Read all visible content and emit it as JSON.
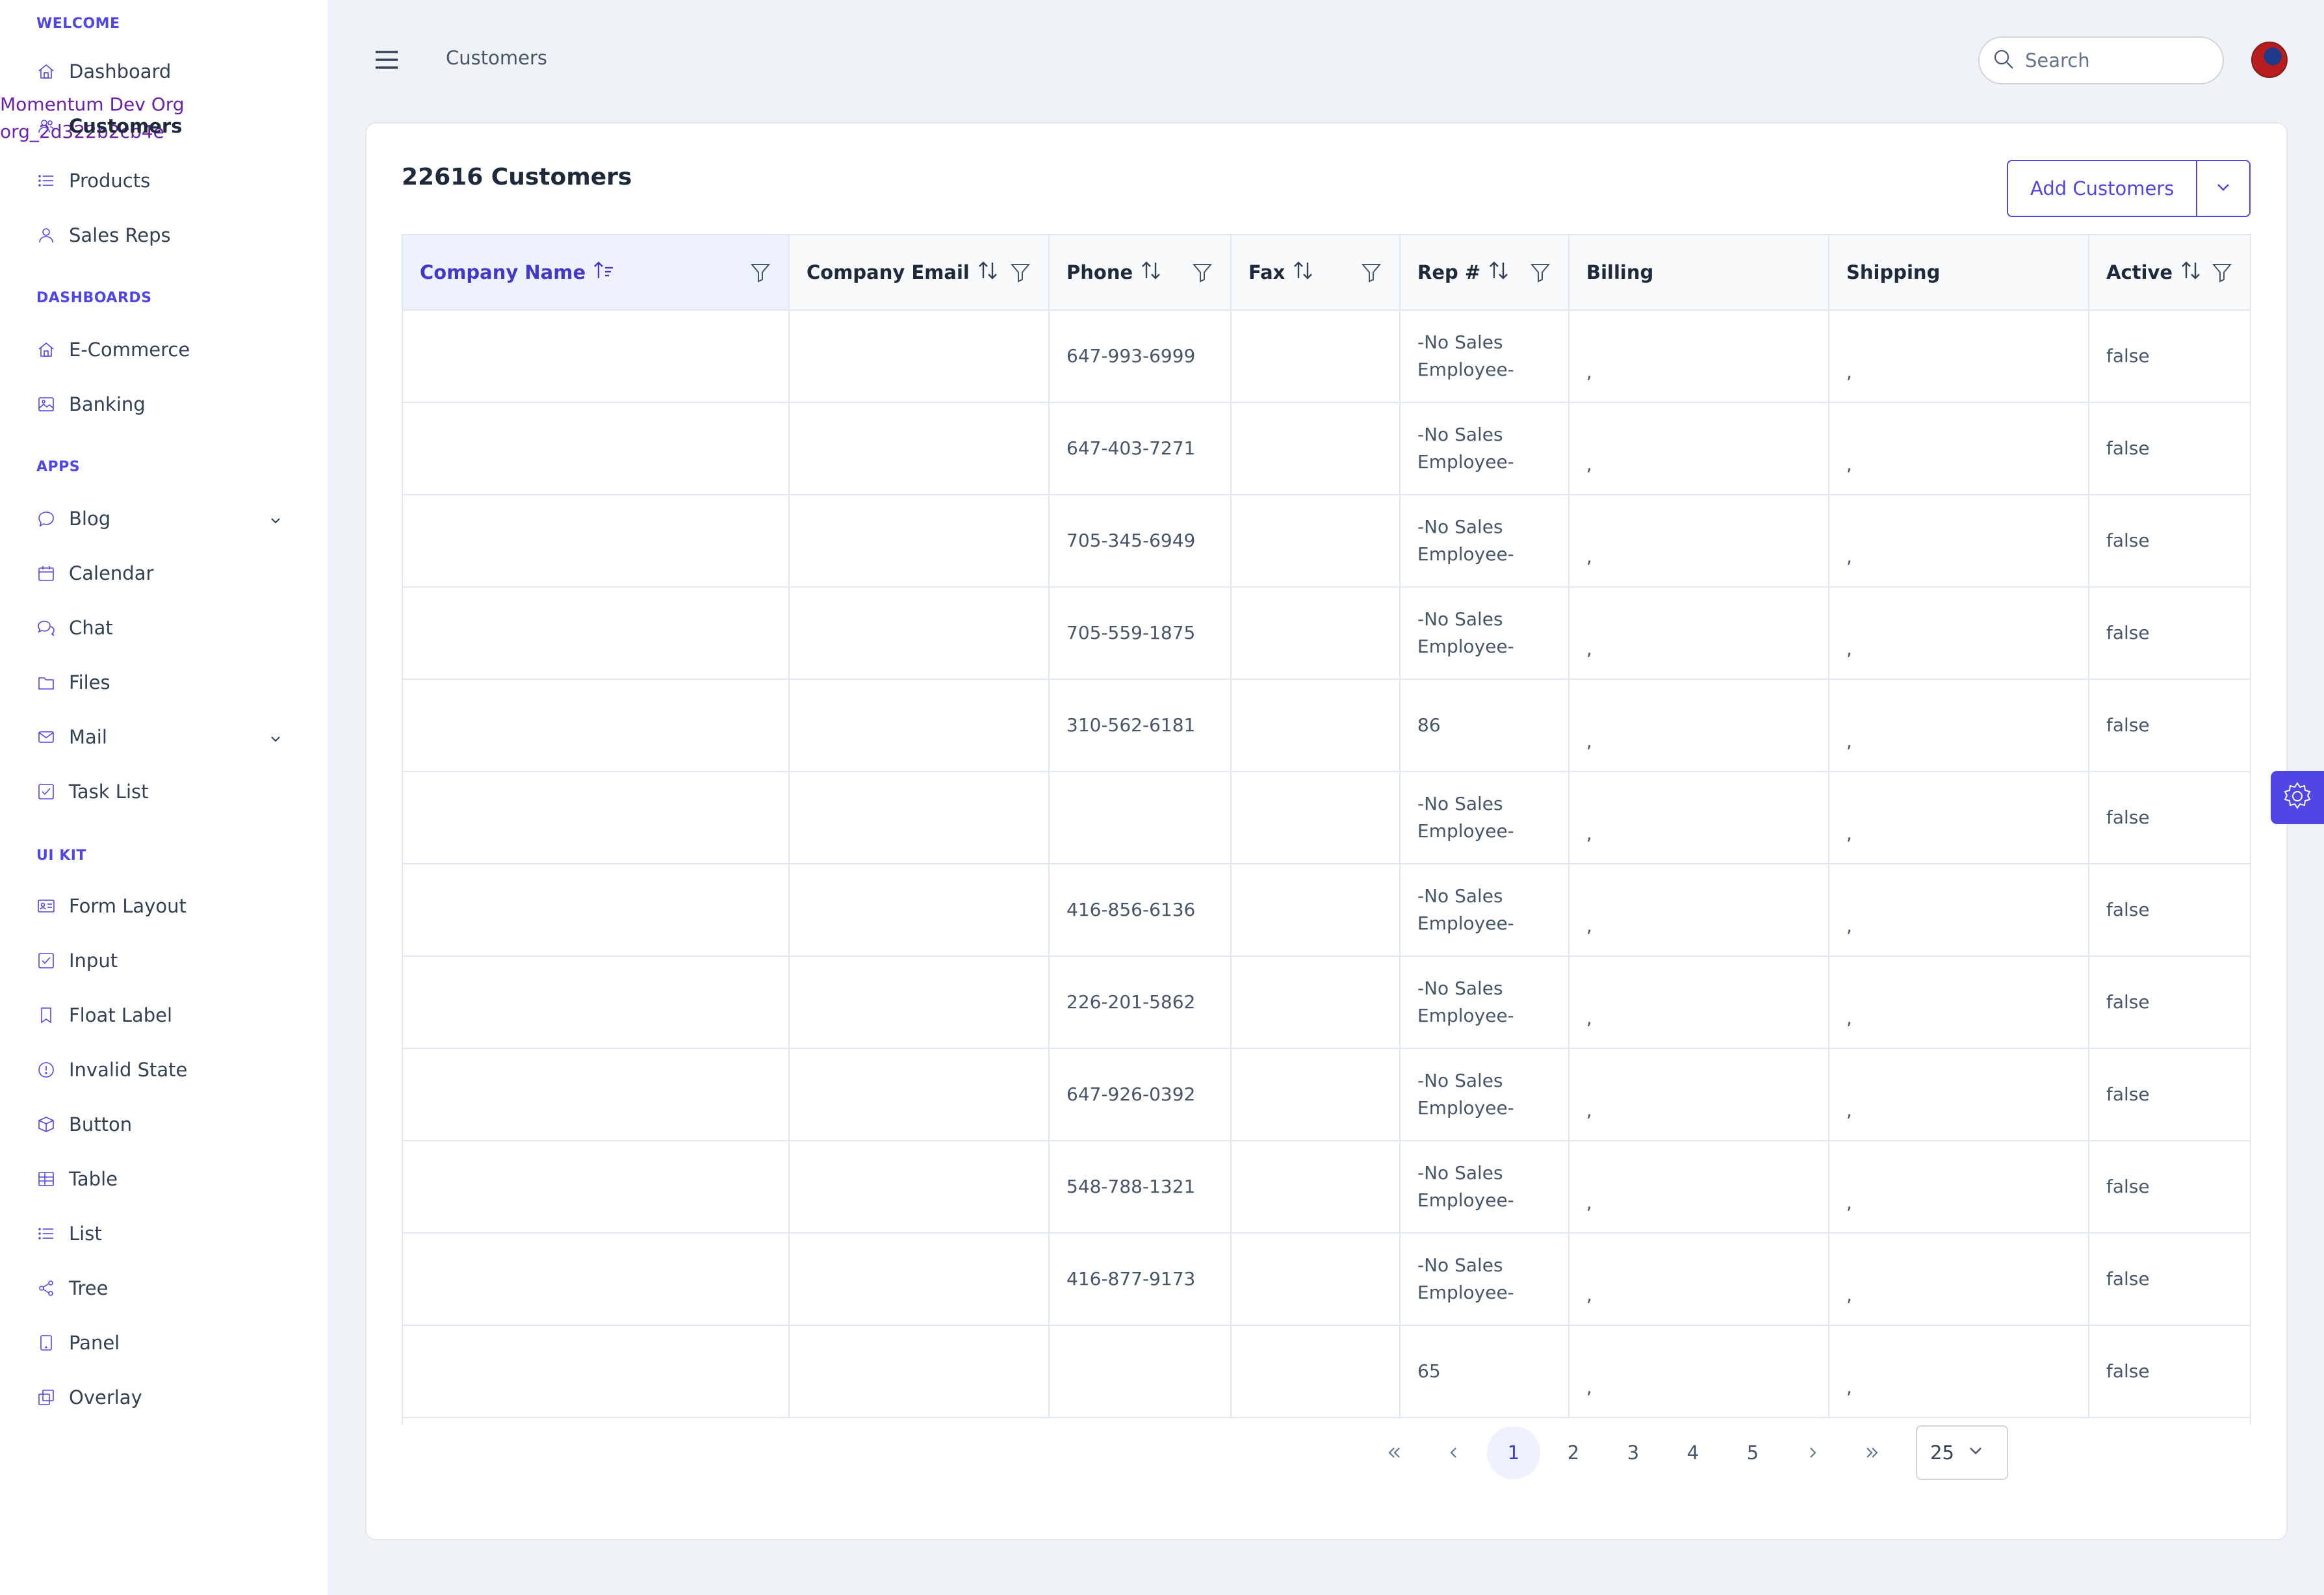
{
  "org": {
    "name": "Momentum Dev Org",
    "id": "org_2d322b2cb4e"
  },
  "sidebar": {
    "sections": [
      {
        "title": "WELCOME",
        "items": [
          {
            "label": "Dashboard",
            "icon": "home-icon"
          },
          {
            "label": "Customers",
            "icon": "users-icon",
            "active": true
          },
          {
            "label": "Products",
            "icon": "list-icon"
          },
          {
            "label": "Sales Reps",
            "icon": "user-icon"
          }
        ]
      },
      {
        "title": "DASHBOARDS",
        "items": [
          {
            "label": "E-Commerce",
            "icon": "home-icon"
          },
          {
            "label": "Banking",
            "icon": "image-icon"
          }
        ]
      },
      {
        "title": "APPS",
        "items": [
          {
            "label": "Blog",
            "icon": "comment-icon",
            "expandable": true
          },
          {
            "label": "Calendar",
            "icon": "calendar-icon"
          },
          {
            "label": "Chat",
            "icon": "comments-icon"
          },
          {
            "label": "Files",
            "icon": "folder-icon"
          },
          {
            "label": "Mail",
            "icon": "envelope-icon",
            "expandable": true
          },
          {
            "label": "Task List",
            "icon": "check-square-icon"
          }
        ]
      },
      {
        "title": "UI KIT",
        "items": [
          {
            "label": "Form Layout",
            "icon": "id-card-icon"
          },
          {
            "label": "Input",
            "icon": "check-square-icon"
          },
          {
            "label": "Float Label",
            "icon": "bookmark-icon"
          },
          {
            "label": "Invalid State",
            "icon": "exclamation-circle-icon"
          },
          {
            "label": "Button",
            "icon": "box-icon"
          },
          {
            "label": "Table",
            "icon": "table-icon"
          },
          {
            "label": "List",
            "icon": "list-icon"
          },
          {
            "label": "Tree",
            "icon": "share-alt-icon"
          },
          {
            "label": "Panel",
            "icon": "tablet-icon"
          },
          {
            "label": "Overlay",
            "icon": "clone-icon"
          }
        ]
      }
    ]
  },
  "topbar": {
    "breadcrumb": "Customers",
    "search_placeholder": "Search"
  },
  "card": {
    "title": "22616 Customers",
    "add_button": "Add Customers"
  },
  "table": {
    "columns": [
      {
        "label": "Company Name",
        "sortable": true,
        "filter": true,
        "sorted": "asc"
      },
      {
        "label": "Company Email",
        "sortable": true,
        "filter": true
      },
      {
        "label": "Phone",
        "sortable": true,
        "filter": true
      },
      {
        "label": "Fax",
        "sortable": true,
        "filter": true
      },
      {
        "label": "Rep #",
        "sortable": true,
        "filter": true
      },
      {
        "label": "Billing",
        "sortable": false,
        "filter": false
      },
      {
        "label": "Shipping",
        "sortable": false,
        "filter": false
      },
      {
        "label": "Active",
        "sortable": true,
        "filter": true
      }
    ],
    "rows": [
      {
        "company": "",
        "email": "",
        "phone": "647-993-6999",
        "fax": "",
        "rep": "-No Sales Employee-",
        "billing": ",",
        "shipping": ",",
        "active": "false"
      },
      {
        "company": "",
        "email": "",
        "phone": "647-403-7271",
        "fax": "",
        "rep": "-No Sales Employee-",
        "billing": ",",
        "shipping": ",",
        "active": "false"
      },
      {
        "company": "",
        "email": "",
        "phone": "705-345-6949",
        "fax": "",
        "rep": "-No Sales Employee-",
        "billing": ",",
        "shipping": ",",
        "active": "false"
      },
      {
        "company": "",
        "email": "",
        "phone": "705-559-1875",
        "fax": "",
        "rep": "-No Sales Employee-",
        "billing": ",",
        "shipping": ",",
        "active": "false"
      },
      {
        "company": "",
        "email": "",
        "phone": "310-562-6181",
        "fax": "",
        "rep": "86",
        "billing": ",",
        "shipping": ",",
        "active": "false"
      },
      {
        "company": "",
        "email": "",
        "phone": "",
        "fax": "",
        "rep": "-No Sales Employee-",
        "billing": ",",
        "shipping": ",",
        "active": "false"
      },
      {
        "company": "",
        "email": "",
        "phone": "416-856-6136",
        "fax": "",
        "rep": "-No Sales Employee-",
        "billing": ",",
        "shipping": ",",
        "active": "false"
      },
      {
        "company": "",
        "email": "",
        "phone": "226-201-5862",
        "fax": "",
        "rep": "-No Sales Employee-",
        "billing": ",",
        "shipping": ",",
        "active": "false"
      },
      {
        "company": "",
        "email": "",
        "phone": "647-926-0392",
        "fax": "",
        "rep": "-No Sales Employee-",
        "billing": ",",
        "shipping": ",",
        "active": "false"
      },
      {
        "company": "",
        "email": "",
        "phone": "548-788-1321",
        "fax": "",
        "rep": "-No Sales Employee-",
        "billing": ",",
        "shipping": ",",
        "active": "false"
      },
      {
        "company": "",
        "email": "",
        "phone": "416-877-9173",
        "fax": "",
        "rep": "-No Sales Employee-",
        "billing": ",",
        "shipping": ",",
        "active": "false"
      },
      {
        "company": "",
        "email": "",
        "phone": "",
        "fax": "",
        "rep": "65",
        "billing": ",",
        "shipping": ",",
        "active": "false"
      }
    ]
  },
  "paginator": {
    "pages": [
      "1",
      "2",
      "3",
      "4",
      "5"
    ],
    "current": "1",
    "rows_per_page": "25"
  },
  "colors": {
    "accent": "#4f46e5",
    "background": "#eff3f8",
    "org_text": "#6b21a8"
  }
}
